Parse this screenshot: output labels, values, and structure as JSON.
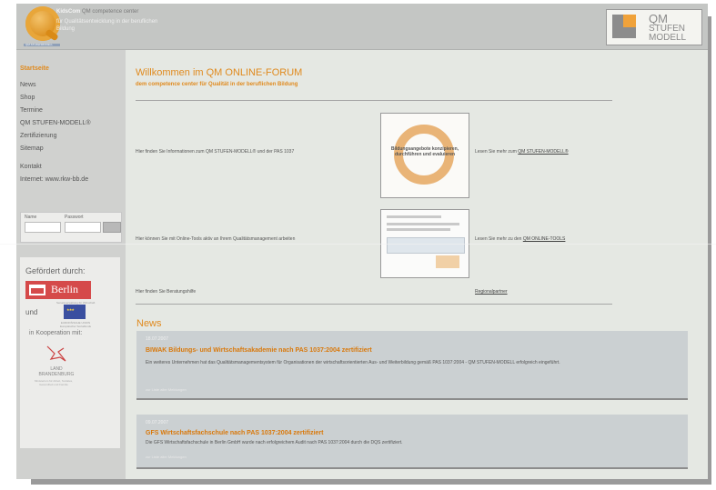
{
  "header": {
    "brand_bold": "KidsCom",
    "brand_cc": "QM competence center",
    "tagline": "für Qualitätsentwicklung in der beruflichen Bildung",
    "logo_sub": "QM STUFENMODELL",
    "qm_logo": [
      "QM",
      "STUFEN",
      "MODELL"
    ],
    "qm_reg": "®"
  },
  "nav": {
    "start": "Startseite",
    "items": [
      "News",
      "Shop",
      "Termine",
      "QM STUFEN-MODELL®",
      "Zertifizierung",
      "Sitemap"
    ],
    "items2": [
      "Kontakt",
      "Internet: www.rkw-bb.de"
    ]
  },
  "login": {
    "name_label": "Name",
    "pass_label": "Passwort"
  },
  "sponsors": {
    "gefoerdert": "Gefördert durch:",
    "berlin": "Berlin",
    "berlin_sub": "Senatsverwaltung für Wirtschaft",
    "und": "und",
    "eu_sub": "EUROPÄISCHE UNION Europäischer Sozialfonds",
    "kooperation": "in Kooperation mit:",
    "land": [
      "LAND",
      "BRANDENBURG"
    ],
    "land_sub": "Ministerium für Arbeit, Soziales, Gesundheit und Familie"
  },
  "main": {
    "title": "Willkommen im QM ONLINE-FORUM",
    "subtitle": "dem competence center für Qualität in der beruflichen Bildung",
    "rows": [
      {
        "text": "Hier finden Sie Informationen zum QM STUFEN-MODELL® und der PAS 1037",
        "link_prefix": "Lesen Sie mehr zum ",
        "link": "QM STUFEN-MODELL®"
      },
      {
        "text": "Hier können Sie mit Online-Tools aktiv an Ihrem Qualitätsmanagement arbeiten",
        "link_prefix": "Lesen Sie mehr zu den ",
        "link": "QM ONLINE-TOOLS"
      },
      {
        "text": "Hier finden Sie Beratungshilfe",
        "link_prefix": "",
        "link": "Regionalpartner"
      }
    ],
    "cycle_text": "Bildungsangebote konzipieren, durchführen und evaluieren"
  },
  "news": {
    "heading": "News",
    "items": [
      {
        "date": "18.07.2007",
        "title": "BIWAK Bildungs- und Wirtschaftsakademie nach PAS 1037:2004 zertifiziert",
        "body": "Ein weiteres Unternehmen hat das Qualitätsmanagementsystem für Organisationen der wirtschaftsorientierten Aus- und Weiterbildung gemäß PAS 1037:2004 - QM STUFEN-MODELL erfolgreich eingeführt.",
        "more": "zur Liste aller Meldungen"
      },
      {
        "date": "09.07.2007",
        "title": "GFS Wirtschaftsfachschule nach PAS 1037:2004 zertifiziert",
        "body": "Die GFS Wirtschaftsfachschule in Berlin GmbH wurde nach erfolgreichem Audit nach PAS 1037:2004 durch die DQS zertifiziert.",
        "more": "zur Liste aller Meldungen"
      }
    ]
  }
}
